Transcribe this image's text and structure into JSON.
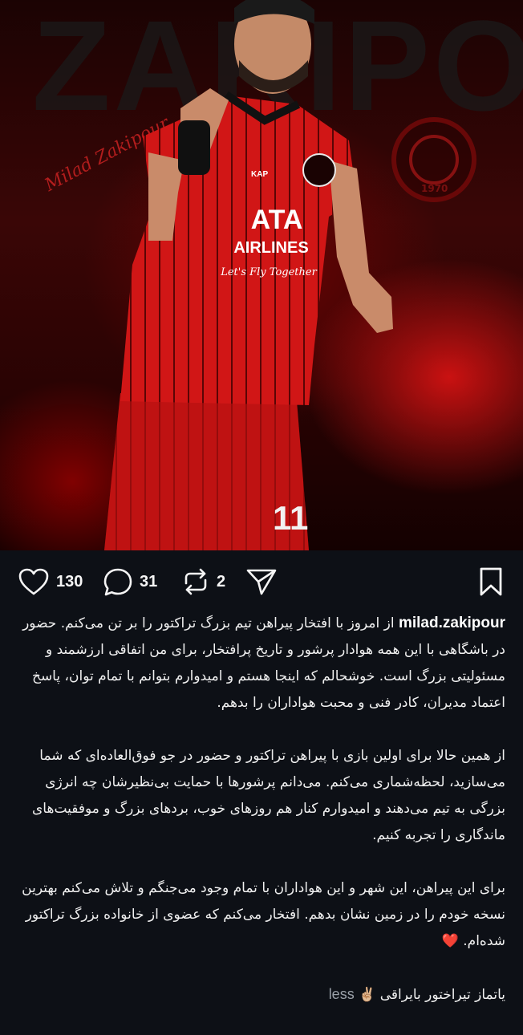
{
  "photo": {
    "bg_text": "ZAKIPOUR",
    "signature": "Milad Zakipour",
    "club_badge_year": "1970",
    "sponsor_line1": "ATA",
    "sponsor_line2": "AIRLINES",
    "sponsor_line3": "Let's Fly Together",
    "jersey_number": "11",
    "kit_brand": "KAP"
  },
  "actions": {
    "likes": "130",
    "comments": "31",
    "reposts": "2"
  },
  "caption": {
    "username": "milad.zakipour",
    "para1_first": "از امروز با افتخار پیراهن تیم بزرگ تراکتور را بر تن",
    "para1_rest": "می‌کنم. حضور در باشگاهی با این همه هوادار پرشور و تاریخ پرافتخار، برای من اتفاقی ارزشمند و مسئولیتی بزرگ است. خوشحالم که اینجا هستم و امیدوارم بتوانم با تمام توان، پاسخ اعتماد مدیران، کادر فنی و محبت هواداران را بدهم.",
    "para2": "از همین حالا برای اولین بازی با پیراهن تراکتور و حضور در جو فوق‌العاده‌ای که شما می‌سازید، لحظه‌شماری می‌کنم. می‌دانم پرشورها با حمایت بی‌نظیرشان چه انرژی بزرگی به تیم می‌دهند و امیدوارم کنار هم روزهای خوب، بردهای بزرگ و موفقیت‌های ماندگاری را تجربه کنیم.",
    "para3": "برای این پیراهن، این شهر و این هواداران با تمام وجود می‌جنگم و تلاش می‌کنم بهترین نسخه خودم را در زمین نشان بدهم. افتخار می‌کنم که عضوی از خانواده بزرگ تراکتور شده‌ام.",
    "heart": "❤️",
    "last_line": "یاتماز تیراختور بایراقی",
    "victory": "✌🏼",
    "less": "less"
  }
}
